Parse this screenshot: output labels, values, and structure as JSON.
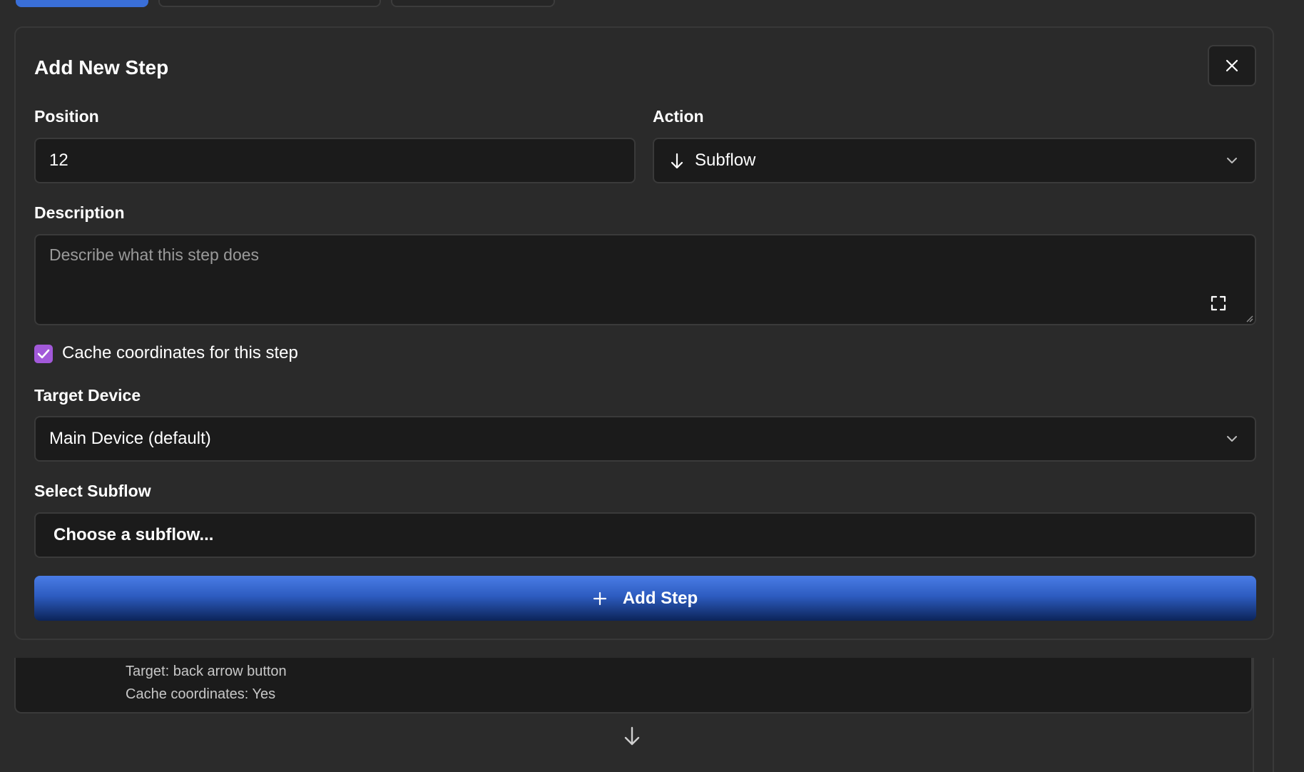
{
  "dialog": {
    "title": "Add New Step",
    "position": {
      "label": "Position",
      "value": "12"
    },
    "action": {
      "label": "Action",
      "value": "Subflow",
      "icon": "arrow-down-icon"
    },
    "description": {
      "label": "Description",
      "placeholder": "Describe what this step does"
    },
    "cache_checkbox": {
      "label": "Cache coordinates for this step",
      "checked": true,
      "color": "#a259d9"
    },
    "target_device": {
      "label": "Target Device",
      "value": "Main Device (default)"
    },
    "subflow": {
      "label": "Select Subflow",
      "value": "Choose a subflow..."
    },
    "add_button": {
      "label": "Add Step",
      "icon": "plus-icon",
      "color": "#3a6fd8"
    }
  },
  "background_step": {
    "target": "Target: back arrow button",
    "cache": "Cache coordinates: Yes"
  }
}
